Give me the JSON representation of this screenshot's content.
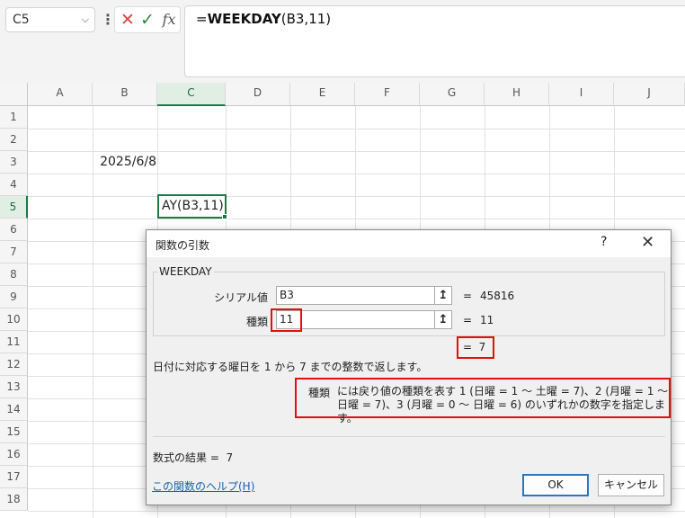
{
  "formula_bar": {
    "name_box": "C5",
    "name_box_dropdown": "⌵",
    "dots": "⋮",
    "cancel_icon": "✕",
    "enter_icon": "✓",
    "fx_label": "fx",
    "formula_prefix": "=",
    "formula_func": "WEEKDAY",
    "formula_args": "(B3,11)"
  },
  "sheet": {
    "columns": [
      "A",
      "B",
      "C",
      "D",
      "E",
      "F",
      "G",
      "H",
      "I",
      "J"
    ],
    "active_column": "C",
    "rows": [
      "1",
      "2",
      "3",
      "4",
      "5",
      "6",
      "7",
      "8",
      "9",
      "10",
      "11",
      "12",
      "13",
      "14",
      "15",
      "16",
      "17",
      "18"
    ],
    "active_row": "5",
    "cells": {
      "B3": "2025/6/8",
      "C5": "AY(B3,11)"
    }
  },
  "dialog": {
    "title": "関数の引数",
    "help_icon": "?",
    "close_icon": "✕",
    "function_name": "WEEKDAY",
    "args": [
      {
        "label": "シリアル値",
        "value": "B3",
        "collapse_icon": "↥",
        "eq": "=",
        "result": "45816"
      },
      {
        "label": "種類",
        "value": "11",
        "collapse_icon": "↥",
        "eq": "=",
        "result": "11"
      }
    ],
    "function_result": "=  7",
    "description": "日付に対応する曜日を 1 から 7 までの整数で返します。",
    "arg_desc_name": "種類",
    "arg_desc_text": "には戻り値の種類を表す 1 (日曜 = 1 ～ 土曜 = 7)、2 (月曜 = 1 ～ 日曜 = 7)、3 (月曜 = 0 ～ 日曜 = 6) のいずれかの数字を指定します。",
    "formula_result_label": "数式の結果 =",
    "formula_result_value": "7",
    "help_link": "この関数のヘルプ(H)",
    "ok_label": "OK",
    "cancel_label": "キャンセル"
  },
  "colors": {
    "selection_green": "#1e7a44",
    "highlight_red": "#e01010",
    "link_blue": "#1a5fb4"
  }
}
